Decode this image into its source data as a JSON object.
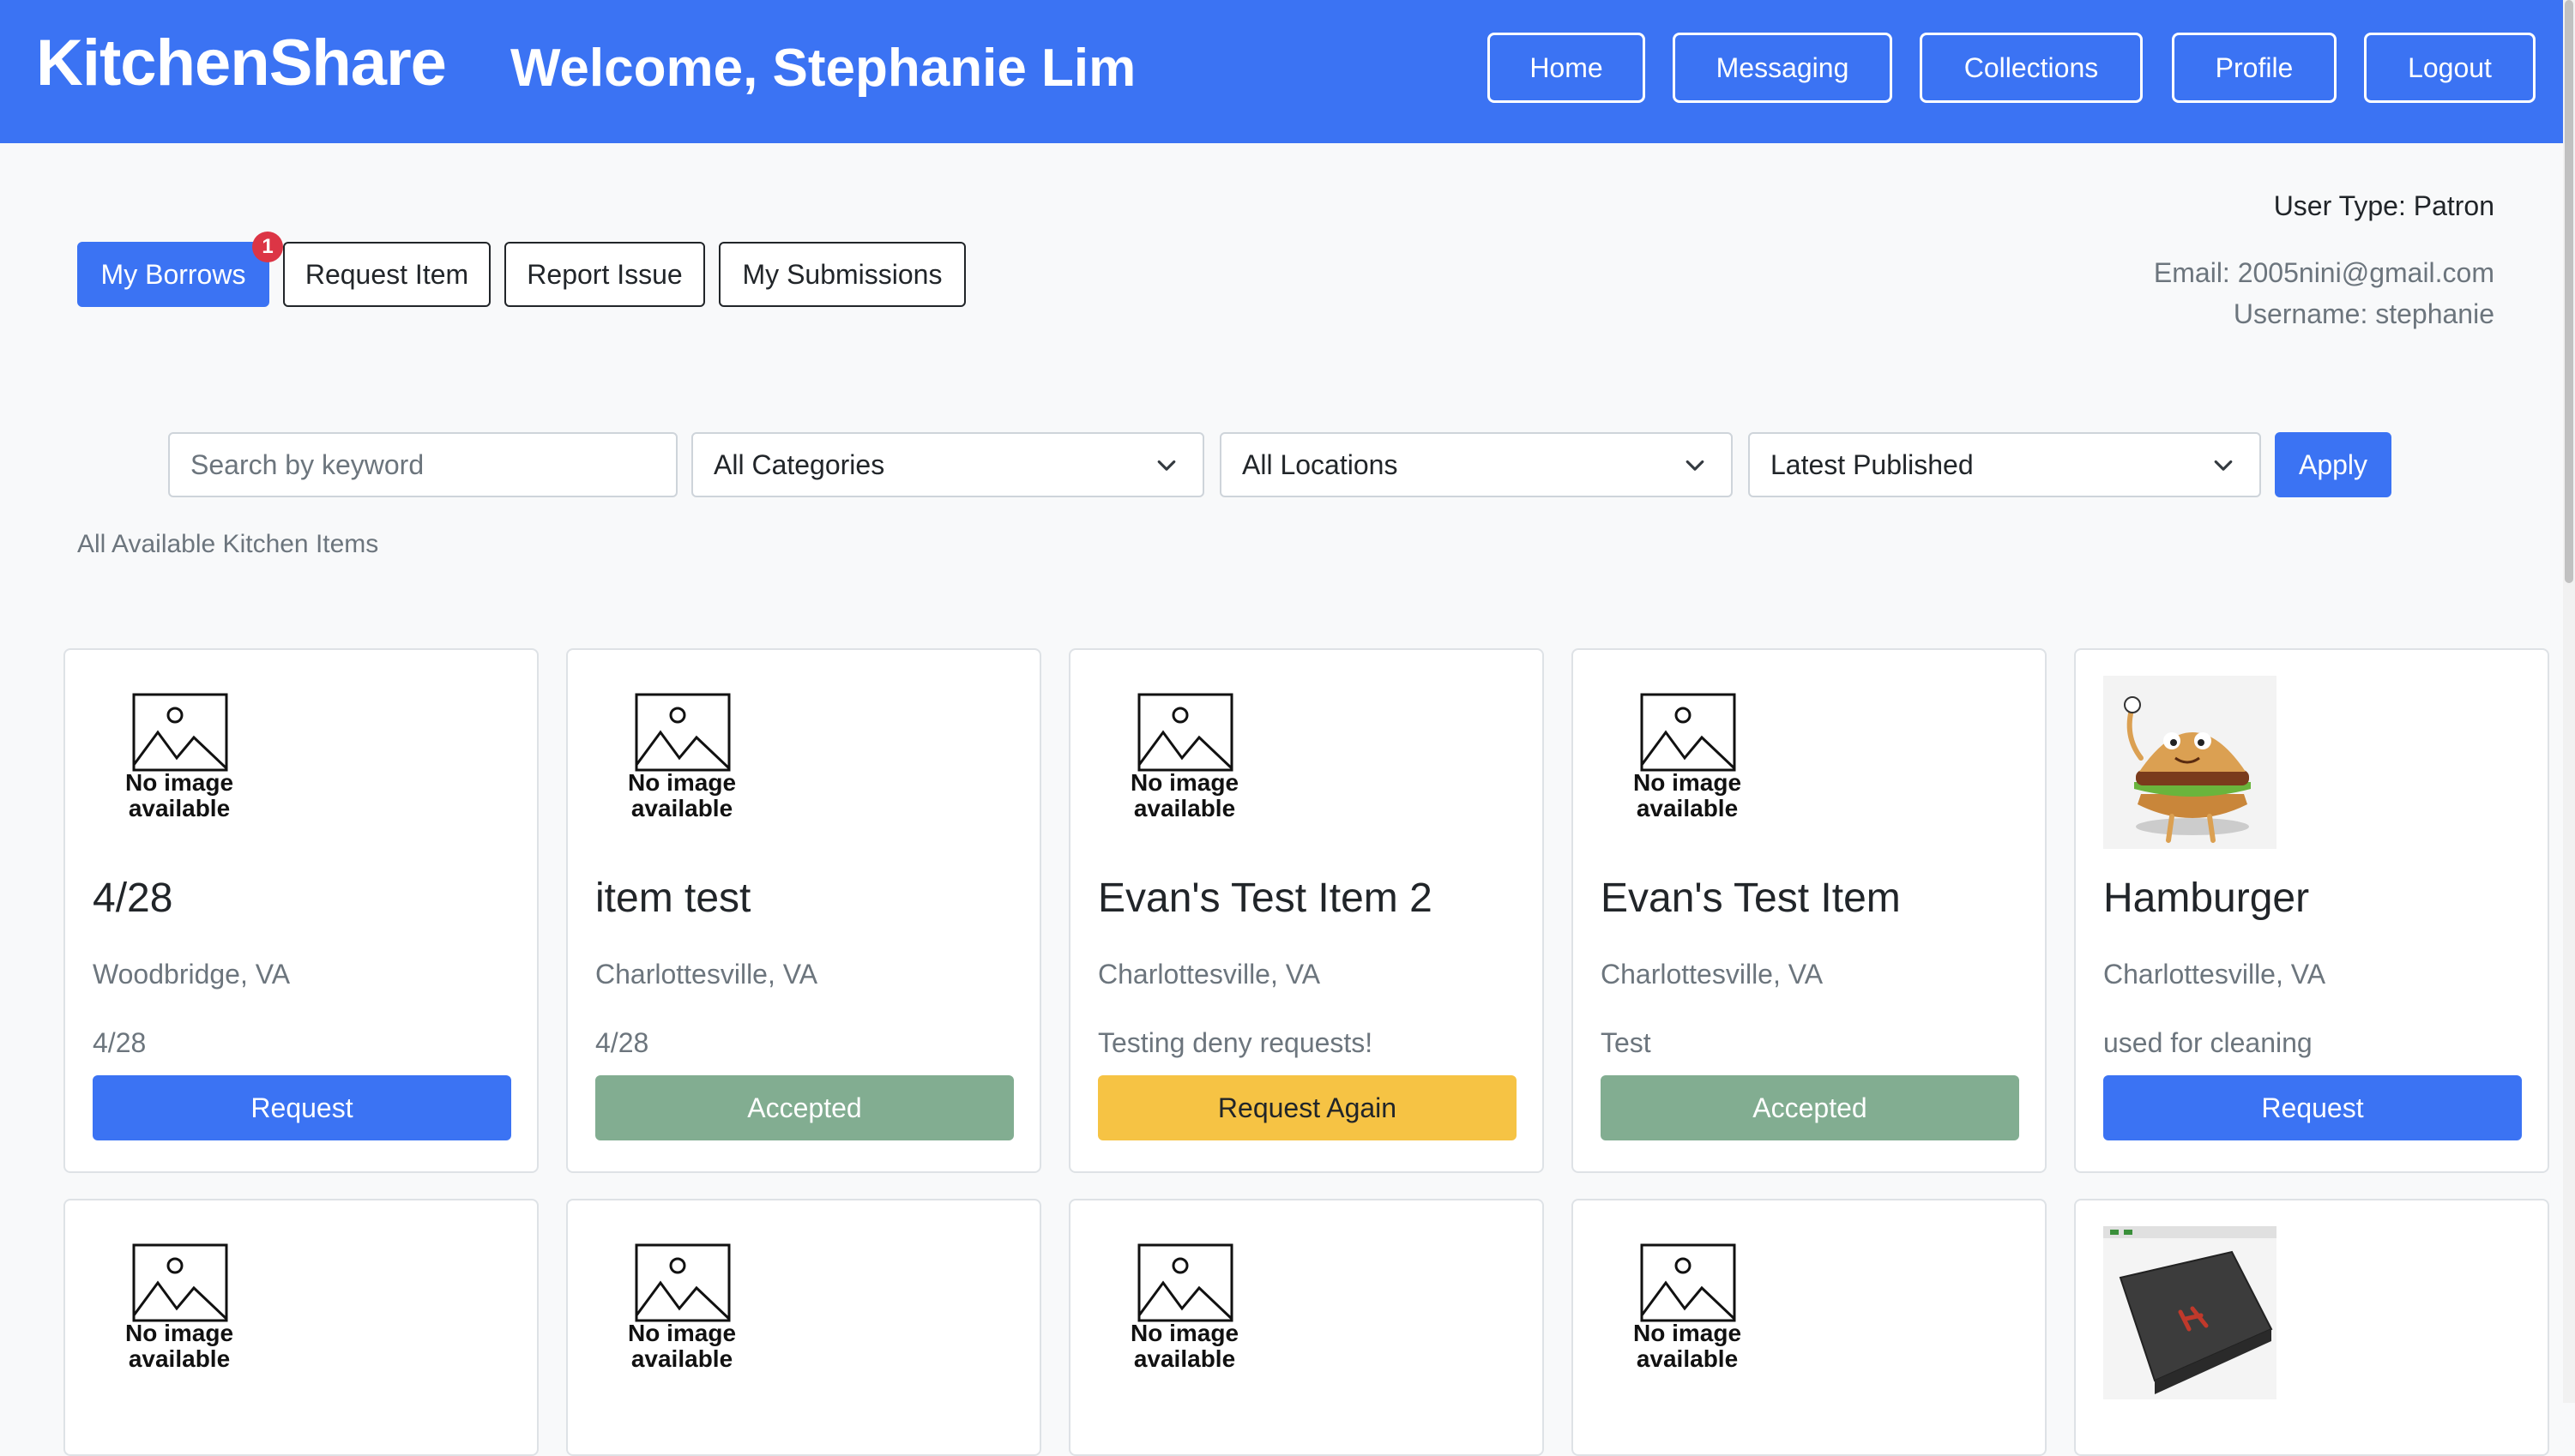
{
  "header": {
    "brand": "KitchenShare",
    "welcome": "Welcome, Stephanie Lim",
    "nav": [
      "Home",
      "Messaging",
      "Collections",
      "Profile",
      "Logout"
    ]
  },
  "tabs": {
    "my_borrows": "My Borrows",
    "my_borrows_badge": "1",
    "request_item": "Request Item",
    "report_issue": "Report Issue",
    "my_submissions": "My Submissions"
  },
  "user": {
    "type": "User Type: Patron",
    "email": "Email: 2005nini@gmail.com",
    "username": "Username: stephanie"
  },
  "filters": {
    "search_placeholder": "Search by keyword",
    "category": "All Categories",
    "location": "All Locations",
    "sort": "Latest Published",
    "apply": "Apply"
  },
  "section_title": "All Available Kitchen Items",
  "no_image_line1": "No image",
  "no_image_line2": "available",
  "items": [
    {
      "title": "4/28",
      "location": "Woodbridge, VA",
      "description": "4/28",
      "action": "Request",
      "status": "request"
    },
    {
      "title": "item test",
      "location": "Charlottesville, VA",
      "description": "4/28",
      "action": "Accepted",
      "status": "accepted"
    },
    {
      "title": "Evan's Test Item 2",
      "location": "Charlottesville, VA",
      "description": "Testing deny requests!",
      "action": "Request Again",
      "status": "again"
    },
    {
      "title": "Evan's Test Item",
      "location": "Charlottesville, VA",
      "description": "Test",
      "action": "Accepted",
      "status": "accepted"
    },
    {
      "title": "Hamburger",
      "location": "Charlottesville, VA",
      "description": "used for cleaning",
      "action": "Request",
      "status": "request"
    }
  ],
  "colors": {
    "primary": "#3b73f3",
    "accepted": "#82ad91",
    "request_again": "#f6c344",
    "badge": "#dc3545"
  }
}
